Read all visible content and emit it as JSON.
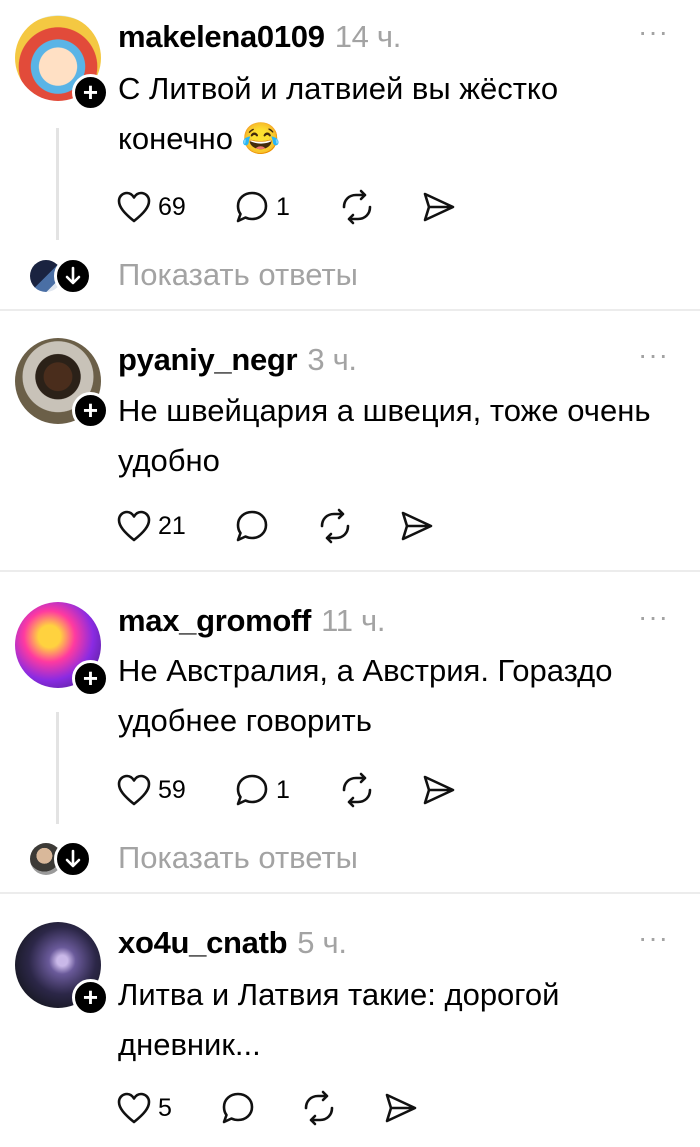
{
  "comments": [
    {
      "username": "makelena0109",
      "time": "14 ч.",
      "text": "С Литвой и латвией вы жёстко конечно 😂",
      "likes": "69",
      "replies": "1",
      "show_replies": "Показать ответы"
    },
    {
      "username": "pyaniy_negr",
      "time": "3 ч.",
      "text": "Не швейцария а швеция, тоже очень удобно",
      "likes": "21",
      "replies": ""
    },
    {
      "username": "max_gromoff",
      "time": "11 ч.",
      "text": "Не Австралия, а Австрия. Гораздо удобнее говорить",
      "likes": "59",
      "replies": "1",
      "show_replies": "Показать ответы"
    },
    {
      "username": "xo4u_cnatb",
      "time": "5 ч.",
      "text": "Литва и Латвия такие: дорогой дневник...",
      "likes": "5",
      "replies": ""
    }
  ],
  "menu_glyph": "···",
  "plus_glyph": "+",
  "colors": {
    "muted": "#a3a3a3",
    "divider": "#ececec",
    "thread": "#e3e3e3"
  }
}
